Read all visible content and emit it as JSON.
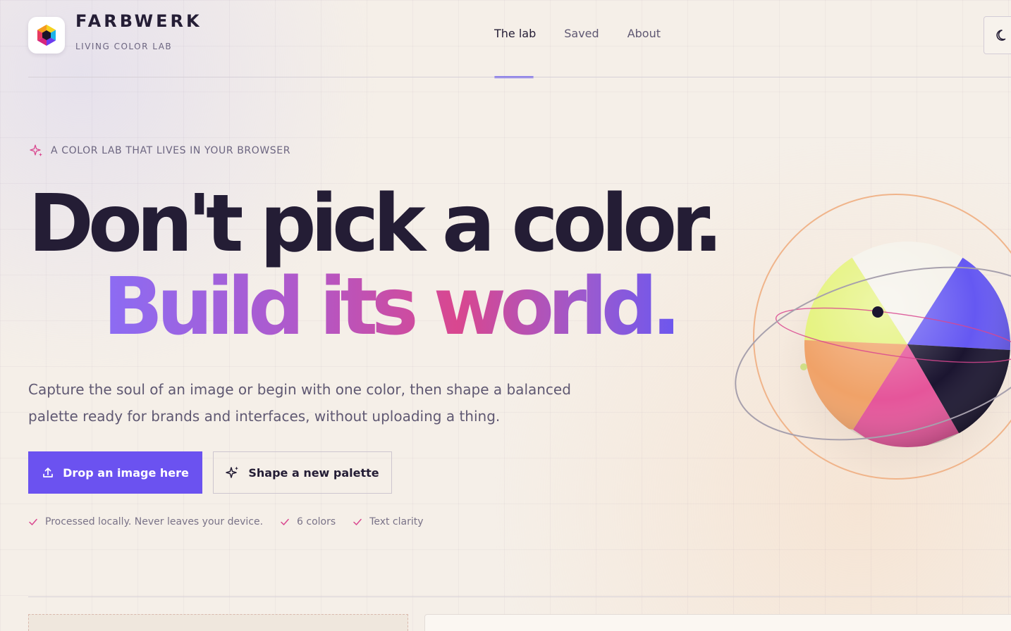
{
  "brand": {
    "name": "FARBWERK",
    "tagline": "LIVING COLOR LAB",
    "logo_icon": "hexagon-cube-logo"
  },
  "nav": {
    "items": [
      {
        "label": "The lab",
        "active": true
      },
      {
        "label": "Saved",
        "active": false
      },
      {
        "label": "About",
        "active": false
      }
    ],
    "theme_toggle_icon": "moon-icon"
  },
  "hero": {
    "eyebrow": "A COLOR LAB THAT LIVES IN YOUR BROWSER",
    "headline_line1": "Don't pick a color.",
    "headline_line2": "Build its world.",
    "lede": "Capture the soul of an image or begin with one color, then shape a balanced palette ready for brands and interfaces, without uploading a thing.",
    "primary_cta": "Drop an image here",
    "secondary_cta": "Shape a new palette",
    "checks": [
      "Processed locally. Never leaves your device.",
      "6 colors",
      "Text clarity"
    ]
  },
  "colors": {
    "accent": "#6b52f0",
    "ink": "#241d35",
    "muted": "#5f5872",
    "check": "#d9478f",
    "sphere_segments": [
      "#e4f27a",
      "#f5f2ea",
      "#6558f2",
      "#1b1530",
      "#e5559a",
      "#f0a268"
    ]
  }
}
